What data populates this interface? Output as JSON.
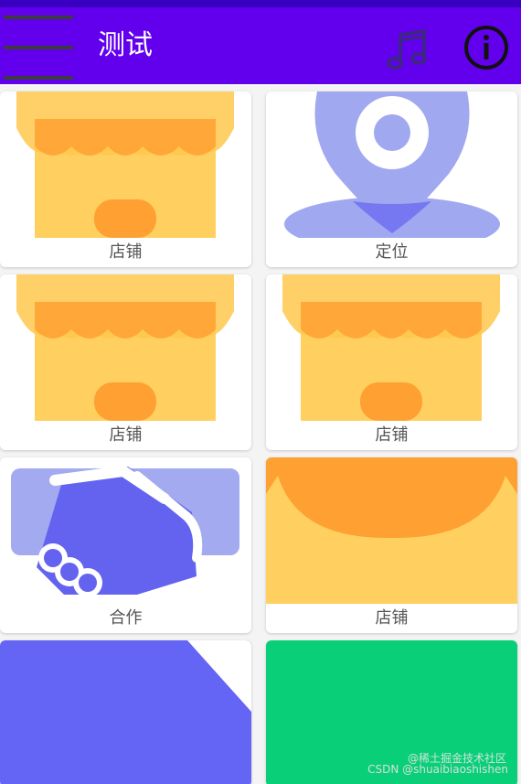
{
  "app": {
    "title": "测试"
  },
  "toolbar": {
    "menu_icon": "hamburger-menu-icon",
    "music_icon": "music-note-icon",
    "info_icon": "info-circle-icon",
    "background": "#6200ee"
  },
  "cards": [
    {
      "label": "店铺",
      "icon": "storefront-icon"
    },
    {
      "label": "定位",
      "icon": "location-pin-icon"
    },
    {
      "label": "店铺",
      "icon": "storefront-icon"
    },
    {
      "label": "店铺",
      "icon": "storefront-icon"
    },
    {
      "label": "合作",
      "icon": "handshake-icon"
    },
    {
      "label": "店铺",
      "icon": "storefront-icon"
    },
    {
      "label": "",
      "icon": "blue-tile"
    },
    {
      "label": "",
      "icon": "green-tile"
    }
  ],
  "watermark": {
    "line1": "@稀土掘金技术社区",
    "line2": "CSDN @shuaibiaoshishen"
  }
}
